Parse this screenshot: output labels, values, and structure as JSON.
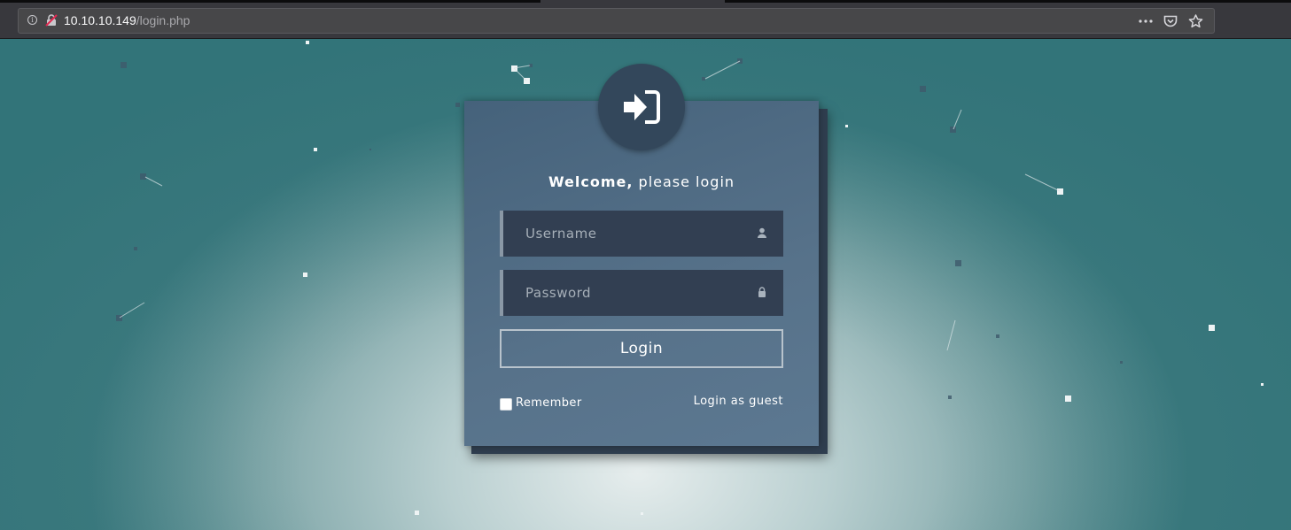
{
  "browser": {
    "url_host": "10.10.10.149",
    "url_path": "/login.php",
    "icons": [
      "info-icon",
      "insecure-connection-icon",
      "more-actions-icon",
      "pocket-icon",
      "bookmark-star-icon"
    ]
  },
  "login": {
    "welcome_bold": "Welcome,",
    "welcome_rest": " please login",
    "username_placeholder": "Username",
    "password_placeholder": "Password",
    "login_label": "Login",
    "remember_label": "Remember",
    "guest_label": "Login as guest"
  },
  "colors": {
    "card": "#56718a",
    "field": "#323f52",
    "avatar": "#33475b",
    "chrome": "#38383d"
  }
}
